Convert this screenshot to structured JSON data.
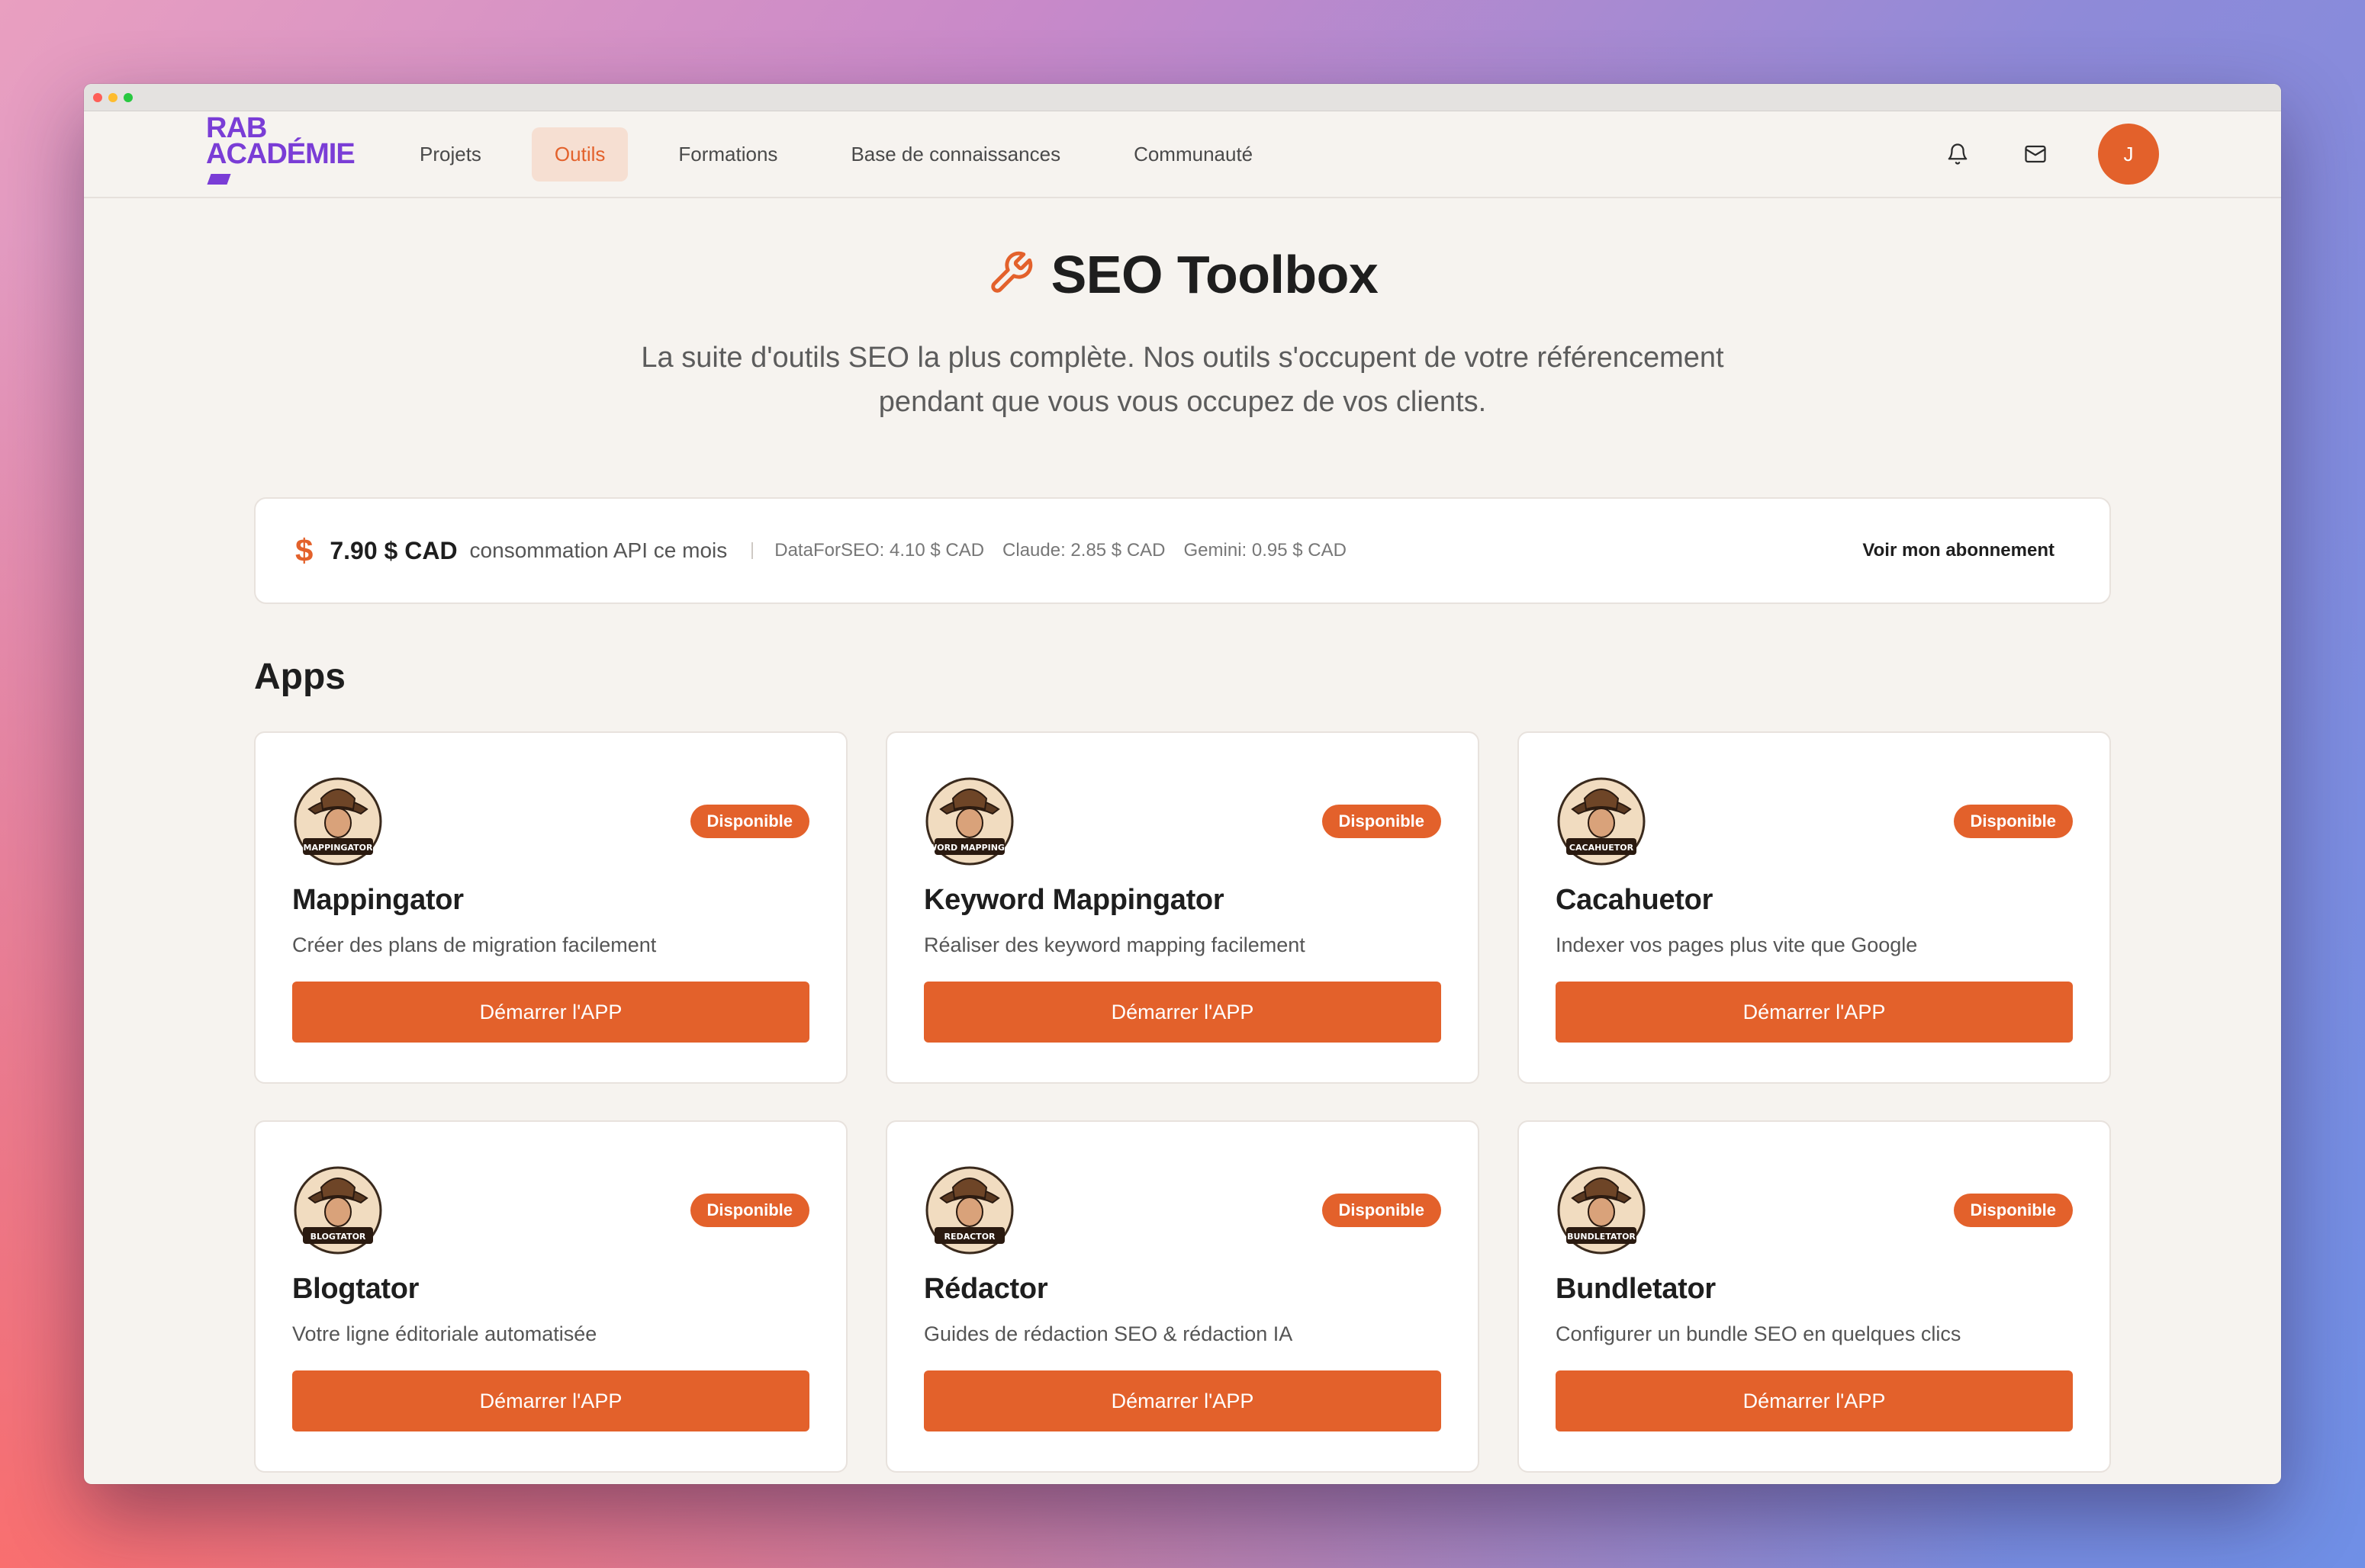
{
  "brand": {
    "line1": "RAB",
    "line2": "ACADÉMIE"
  },
  "nav": {
    "items": [
      {
        "label": "Projets",
        "active": false
      },
      {
        "label": "Outils",
        "active": true
      },
      {
        "label": "Formations",
        "active": false
      },
      {
        "label": "Base de connaissances",
        "active": false
      },
      {
        "label": "Communauté",
        "active": false
      }
    ],
    "avatar_initial": "J"
  },
  "hero": {
    "title": "SEO Toolbox",
    "subtitle": "La suite d'outils SEO la plus complète. Nos outils s'occupent de votre référencement pendant que vous vous occupez de vos clients."
  },
  "usage": {
    "currency_symbol": "$",
    "amount": "7.90 $ CAD",
    "description": "consommation API ce mois",
    "details": [
      "DataForSEO: 4.10 $ CAD",
      "Claude: 2.85 $ CAD",
      "Gemini: 0.95 $ CAD"
    ],
    "link": "Voir mon abonnement"
  },
  "apps_section": {
    "title": "Apps",
    "apps": [
      {
        "name": "Mappingator",
        "description": "Créer des plans de migration facilement",
        "badge": "Disponible",
        "button": "Démarrer l'APP",
        "logo_label": "MAPPINGATOR",
        "logo_icon": "cowboy-crocodile-icon"
      },
      {
        "name": "Keyword Mappingator",
        "description": "Réaliser des keyword mapping facilement",
        "badge": "Disponible",
        "button": "Démarrer l'APP",
        "logo_label": "KEYWORD MAPPINGATOR",
        "logo_icon": "cowboy-seo-icon"
      },
      {
        "name": "Cacahuetor",
        "description": "Indexer vos pages plus vite que Google",
        "badge": "Disponible",
        "button": "Démarrer l'APP",
        "logo_label": "CACAHUETOR",
        "logo_icon": "cowboy-peanut-icon"
      },
      {
        "name": "Blogtator",
        "description": "Votre ligne éditoriale automatisée",
        "badge": "Disponible",
        "button": "Démarrer l'APP",
        "logo_label": "BLOGTATOR",
        "logo_icon": "cowboy-newspaper-icon"
      },
      {
        "name": "Rédactor",
        "description": "Guides de rédaction SEO & rédaction IA",
        "badge": "Disponible",
        "button": "Démarrer l'APP",
        "logo_label": "REDACTOR",
        "logo_icon": "cowboy-quill-icon"
      },
      {
        "name": "Bundletator",
        "description": "Configurer un bundle SEO en quelques clics",
        "badge": "Disponible",
        "button": "Démarrer l'APP",
        "logo_label": "BUNDLETATOR",
        "logo_icon": "cowboy-bundle-icon"
      }
    ]
  },
  "colors": {
    "accent": "#e3612b",
    "brand": "#7a3dd6",
    "background": "#f6f3ef"
  }
}
